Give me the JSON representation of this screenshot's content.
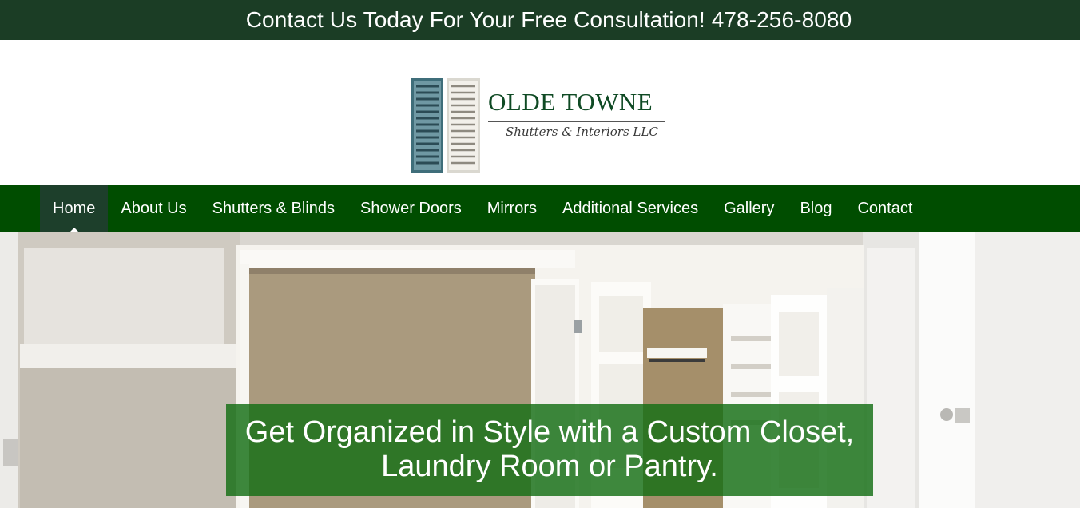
{
  "top_bar": {
    "text": "Contact Us Today For Your Free Consultation! 478-256-8080"
  },
  "logo": {
    "title": "OLDE TOWNE",
    "subtitle": "Shutters & Interiors LLC"
  },
  "nav": {
    "items": [
      {
        "label": "Home",
        "active": true
      },
      {
        "label": "About Us"
      },
      {
        "label": "Shutters & Blinds"
      },
      {
        "label": "Shower Doors"
      },
      {
        "label": "Mirrors"
      },
      {
        "label": "Additional Services"
      },
      {
        "label": "Gallery"
      },
      {
        "label": "Blog"
      },
      {
        "label": "Contact"
      }
    ]
  },
  "hero": {
    "caption_line1": "Get Organized in Style with a Custom Closet,",
    "caption_line2": "Laundry Room or Pantry."
  },
  "colors": {
    "top_bar_bg": "#1b3d25",
    "nav_bg": "#004d00",
    "nav_active_bg": "#1d3f2b",
    "caption_bg": "#146e14",
    "logo_title": "#0f4a24"
  }
}
